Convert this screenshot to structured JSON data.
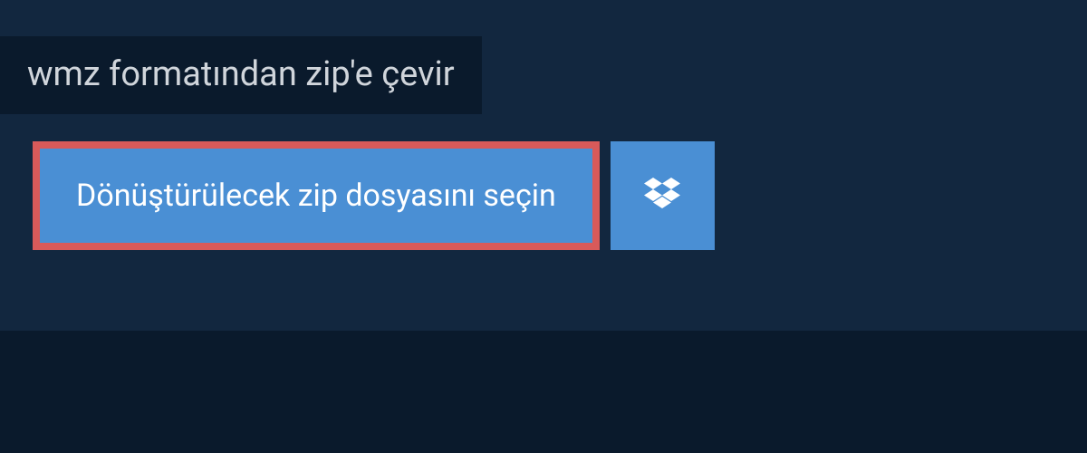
{
  "header": {
    "title": "wmz formatından zip'e çevir"
  },
  "actions": {
    "select_file_label": "Dönüştürülecek zip dosyasını seçin"
  },
  "colors": {
    "background": "#12273f",
    "dark_panel": "#0a1a2c",
    "button_blue": "#4a8fd4",
    "highlight_border": "#d85a5a",
    "text_light": "#d0d5db"
  }
}
